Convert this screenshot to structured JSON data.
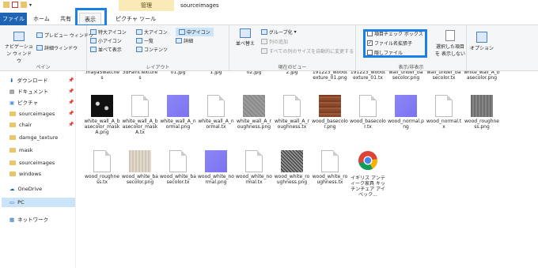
{
  "window": {
    "title": "sourceimages",
    "context_tab": "管理"
  },
  "tabs": [
    "ファイル",
    "ホーム",
    "共有",
    "表示",
    "ピクチャ ツール"
  ],
  "ribbon": {
    "groups": [
      "ペイン",
      "レイアウト",
      "現在のビュー",
      "表示/非表示"
    ],
    "nav_pane": "ナビゲーション ウィンドウ",
    "preview": "プレビュー ウィンドウ",
    "details": "詳細ウィンドウ",
    "layout": [
      "特大アイコン",
      "大アイコン",
      "中アイコン",
      "小アイコン",
      "一覧",
      "詳細",
      "並べて表示",
      "コンテンツ"
    ],
    "sort": "並べ替え",
    "group_by": "グループ化",
    "add_column": "列の追加",
    "fit_columns": "すべての列のサイズを自動的に変更する",
    "item_checkbox": "項目チェック ボックス",
    "file_ext": "ファイル名拡張子",
    "hidden": "隠しファイル",
    "hide_selected": "選択した項目を 表示しない",
    "options": "オプション"
  },
  "nav": {
    "items": [
      "ダウンロード",
      "ドキュメント",
      "ピクチャ",
      "sourceimages",
      "chair",
      "damge_texture",
      "mask",
      "sourceimages",
      "windows",
      "OneDrive",
      "PC",
      "ネットワーク"
    ]
  },
  "row0": [
    ".mayaSwatches",
    "3dPaintTextures",
    "01.jpg",
    "1.jpg",
    "02.jpg",
    "2.jpg",
    "191223_woodtexture_01.png",
    "191223_woodtexture_01.tx",
    "wall_under_basecolor.png",
    "wall_under_basecolor.tx",
    "white_wall_A_basecolor.png"
  ],
  "files": [
    {
      "name": "white_wall_A_basecolor_maskA.png",
      "kind": "mask"
    },
    {
      "name": "white_wall_A_basecolor_maskA.tx",
      "kind": "doc"
    },
    {
      "name": "white_wall_A_normal.png",
      "kind": "normal"
    },
    {
      "name": "white_wall_A_normal.tx",
      "kind": "doc"
    },
    {
      "name": "white_wall_A_roughness.png",
      "kind": "gray"
    },
    {
      "name": "white_wall_A_roughness.tx",
      "kind": "doc"
    },
    {
      "name": "wood_basecolor.png",
      "kind": "wood"
    },
    {
      "name": "wood_basecolor.tx",
      "kind": "doc"
    },
    {
      "name": "wood_normal.png",
      "kind": "normal"
    },
    {
      "name": "wood_normal.tx",
      "kind": "doc"
    },
    {
      "name": "wood_roughness.png",
      "kind": "dgray"
    },
    {
      "name": "wood_roughness.tx",
      "kind": "doc"
    },
    {
      "name": "wood_white_basecolor.png",
      "kind": "paper"
    },
    {
      "name": "wood_white_basecolor.tx",
      "kind": "doc"
    },
    {
      "name": "wood_white_normal.png",
      "kind": "normal"
    },
    {
      "name": "wood_white_normal.tx",
      "kind": "doc"
    },
    {
      "name": "wood_white_roughness.png",
      "kind": "noise"
    },
    {
      "name": "wood_white_roughness.tx",
      "kind": "doc"
    },
    {
      "name": "イギリス アンティーク家具 キッチンチェア アイベック...",
      "kind": "chrome"
    }
  ]
}
